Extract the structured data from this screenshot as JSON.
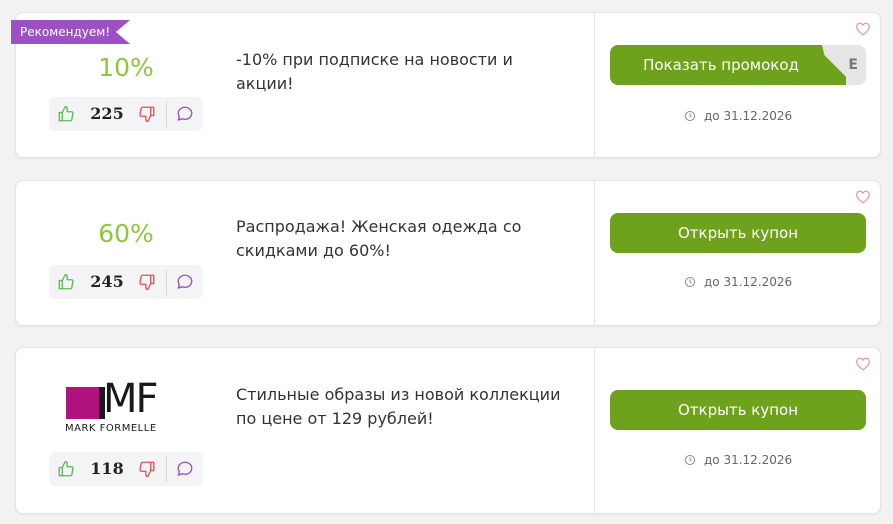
{
  "coupons": [
    {
      "badge": "Рекомендуем!",
      "discount": "10%",
      "votes": "225",
      "description": "-10% при подписке на новости и акции!",
      "button": "Показать промокод",
      "code_peek": "E",
      "expiry": "до 31.12.2026"
    },
    {
      "discount": "60%",
      "votes": "245",
      "description": "Распродажа! Женская одежда со скидками до 60%!",
      "button": "Открыть купон",
      "expiry": "до 31.12.2026"
    },
    {
      "logo_text": "MF",
      "logo_subtext": "MARK FORMELLE",
      "votes": "118",
      "description": "Стильные образы из новой коллекции по цене от 129 рублей!",
      "button": "Открыть купон",
      "expiry": "до 31.12.2026"
    }
  ],
  "icons": {
    "upvote": "thumbs-up-icon",
    "downvote": "thumbs-down-icon",
    "comment": "comment-icon",
    "expiry": "clock-icon",
    "favorite": "heart-icon"
  },
  "colors": {
    "accent_green": "#6fa21c",
    "discount_green": "#8dc63f",
    "badge_purple": "#9b51c4",
    "upvote": "#5cb85c",
    "downvote": "#e05252",
    "comment": "#9b51c4",
    "heart": "#e89aa0",
    "brand_magenta": "#b0127f"
  }
}
